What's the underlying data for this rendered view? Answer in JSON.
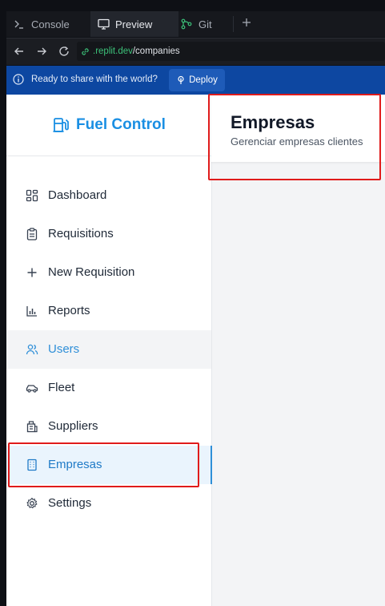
{
  "tabs": [
    {
      "label": "Console",
      "icon": "terminal-icon"
    },
    {
      "label": "Preview",
      "icon": "monitor-icon"
    },
    {
      "label": "Git",
      "icon": "git-icon"
    }
  ],
  "url": {
    "domain": ".replit.dev",
    "path": "/companies"
  },
  "banner": {
    "message": "Ready to share with the world?",
    "deploy_label": "Deploy"
  },
  "brand": {
    "name": "Fuel Control",
    "icon": "fuel-pump-icon"
  },
  "nav": [
    {
      "label": "Dashboard",
      "icon": "grid-icon"
    },
    {
      "label": "Requisitions",
      "icon": "clipboard-icon"
    },
    {
      "label": "New Requisition",
      "icon": "plus-icon"
    },
    {
      "label": "Reports",
      "icon": "bar-chart-icon"
    },
    {
      "label": "Users",
      "icon": "users-icon"
    },
    {
      "label": "Fleet",
      "icon": "car-icon"
    },
    {
      "label": "Suppliers",
      "icon": "store-icon"
    },
    {
      "label": "Empresas",
      "icon": "building-icon"
    },
    {
      "label": "Settings",
      "icon": "gear-icon"
    }
  ],
  "header": {
    "title": "Empresas",
    "subtitle": "Gerenciar empresas clientes"
  },
  "colors": {
    "accent": "#1a8fe3",
    "highlight": "#e01b1b",
    "banner": "#0d47a1"
  }
}
